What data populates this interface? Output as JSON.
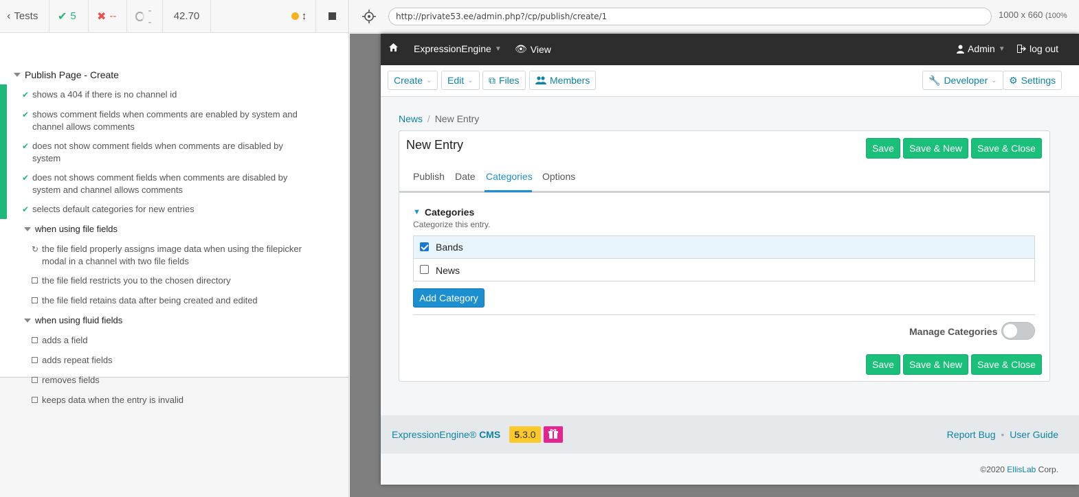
{
  "runner": {
    "tests_label": "Tests",
    "passed": "5",
    "failed": "--",
    "pending": "--",
    "duration": "42.70",
    "suite_title": "Publish Page - Create",
    "tests": [
      {
        "text": "shows a 404 if there is no channel id",
        "state": "passed"
      },
      {
        "text": "shows comment fields when comments are enabled by system and",
        "text2": "channel allows comments",
        "state": "passed"
      },
      {
        "text": "does not show comment fields when comments are disabled by",
        "text2": "system",
        "state": "passed"
      },
      {
        "text": "does not shows comment fields when comments are disabled by",
        "text2": "system and channel allows comments",
        "state": "passed"
      },
      {
        "text": "selects default categories for new entries",
        "state": "passed"
      }
    ],
    "file_suite_title": "when using file fields",
    "file_tests": [
      {
        "text": "the file field properly assigns image data when using the filepicker",
        "text2": "modal in a channel with two file fields",
        "state": "running"
      },
      {
        "text": "the file field restricts you to the chosen directory",
        "state": "pending"
      },
      {
        "text": "the file field retains data after being created and edited",
        "state": "pending"
      }
    ],
    "fluid_suite_title": "when using fluid fields",
    "fluid_tests": [
      {
        "text": "adds a field",
        "state": "pending"
      },
      {
        "text": "adds repeat fields",
        "state": "pending"
      },
      {
        "text": "removes fields",
        "state": "pending"
      },
      {
        "text": "keeps data when the entry is invalid",
        "state": "pending"
      }
    ]
  },
  "browser": {
    "url": "http://private53.ee/admin.php?/cp/publish/create/1",
    "viewport": "1000 x 660",
    "zoom": "(100%"
  },
  "ee": {
    "site_name": "ExpressionEngine",
    "view_label": "View",
    "user_label": "Admin",
    "logout_label": "log out",
    "nav": {
      "create": "Create",
      "edit": "Edit",
      "files": "Files",
      "members": "Members",
      "developer": "Developer",
      "settings": "Settings"
    },
    "breadcrumb": {
      "parent": "News",
      "sep": "/",
      "current": "New Entry"
    },
    "panel_title": "New Entry",
    "buttons": {
      "save": "Save",
      "save_new": "Save & New",
      "save_close": "Save & Close"
    },
    "tabs": [
      "Publish",
      "Date",
      "Categories",
      "Options"
    ],
    "section_title": "Categories",
    "section_sub": "Categorize this entry.",
    "categories": [
      {
        "name": "Bands",
        "checked": true
      },
      {
        "name": "News",
        "checked": false
      }
    ],
    "add_category": "Add Category",
    "manage_categories": "Manage Categories",
    "footer": {
      "brand": "ExpressionEngine®",
      "brand_cms": "CMS",
      "version_major": "5",
      "version_rest": ".3.0",
      "report_bug": "Report Bug",
      "user_guide": "User Guide",
      "copyright": "©2020",
      "company": "EllisLab",
      "corp": "Corp."
    }
  }
}
